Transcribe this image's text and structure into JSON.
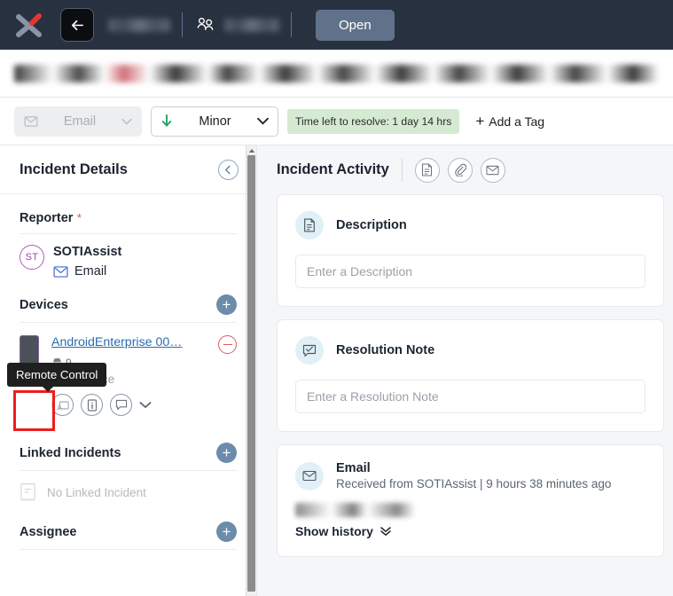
{
  "topbar": {
    "logo_icon": "soti-x-logo",
    "back_icon": "arrow-left-icon",
    "people_icon": "two-people-icon",
    "open_label": "Open"
  },
  "toolbar": {
    "channel": {
      "label": "Email",
      "icon": "envelope-icon",
      "chevron": "chevron-down-icon",
      "disabled": true
    },
    "priority": {
      "label": "Minor",
      "icon": "arrow-down-icon",
      "chevron": "chevron-down-icon"
    },
    "sla_badge": "Time left to resolve: 1 day 14 hrs",
    "add_tag_label": "Add a Tag",
    "add_tag_plus": "+"
  },
  "left_panel": {
    "title": "Incident Details",
    "collapse_icon": "chevron-left-icon",
    "reporter": {
      "label": "Reporter",
      "required_mark": "*",
      "avatar_initials": "ST",
      "name": "SOTIAssist",
      "contact_label": "Email",
      "contact_icon": "envelope-icon"
    },
    "devices": {
      "label": "Devices",
      "add_icon": "plus-icon",
      "device_name": "AndroidEnterprise 00…",
      "os_icon": "android-icon",
      "os_version": "9",
      "compliance": "Compliance",
      "remove_icon": "minus-icon",
      "actions": [
        {
          "name": "remote-control",
          "icon": "remote-control-icon",
          "highlighted": true
        },
        {
          "name": "device-info",
          "icon": "device-info-icon",
          "highlighted": false
        },
        {
          "name": "send-message",
          "icon": "chat-bubble-icon",
          "highlighted": false
        }
      ],
      "more_icon": "chevron-down-icon",
      "tooltip": "Remote Control"
    },
    "linked_incidents": {
      "label": "Linked Incidents",
      "add_icon": "plus-icon",
      "empty_icon": "document-icon",
      "empty_text": "No Linked Incident"
    },
    "assignee": {
      "label": "Assignee",
      "add_icon": "plus-icon"
    }
  },
  "right_panel": {
    "title": "Incident Activity",
    "header_icons": [
      {
        "name": "note-icon",
        "label": "note"
      },
      {
        "name": "attachment-icon",
        "label": "attachment"
      },
      {
        "name": "email-icon",
        "label": "email"
      }
    ],
    "cards": [
      {
        "icon": "document-icon",
        "title": "Description",
        "placeholder": "Enter a Description"
      },
      {
        "icon": "check-bubble-icon",
        "title": "Resolution Note",
        "placeholder": "Enter a Resolution Note"
      },
      {
        "icon": "envelope-icon",
        "title": "Email",
        "subtitle": "Received from SOTIAssist  |  9 hours 38 minutes ago",
        "show_history_label": "Show history",
        "show_history_icon": "double-chevron-down-icon"
      }
    ]
  },
  "colors": {
    "topbar_bg": "#28313f",
    "open_btn": "#60728a",
    "accent_red": "#ee1c1c",
    "sla_green": "#d5ead2",
    "priority_green": "#21a366",
    "link_blue": "#2b6cb0",
    "plus_blue": "#6d8cab",
    "avatar_purple": "#9b3fb0"
  }
}
